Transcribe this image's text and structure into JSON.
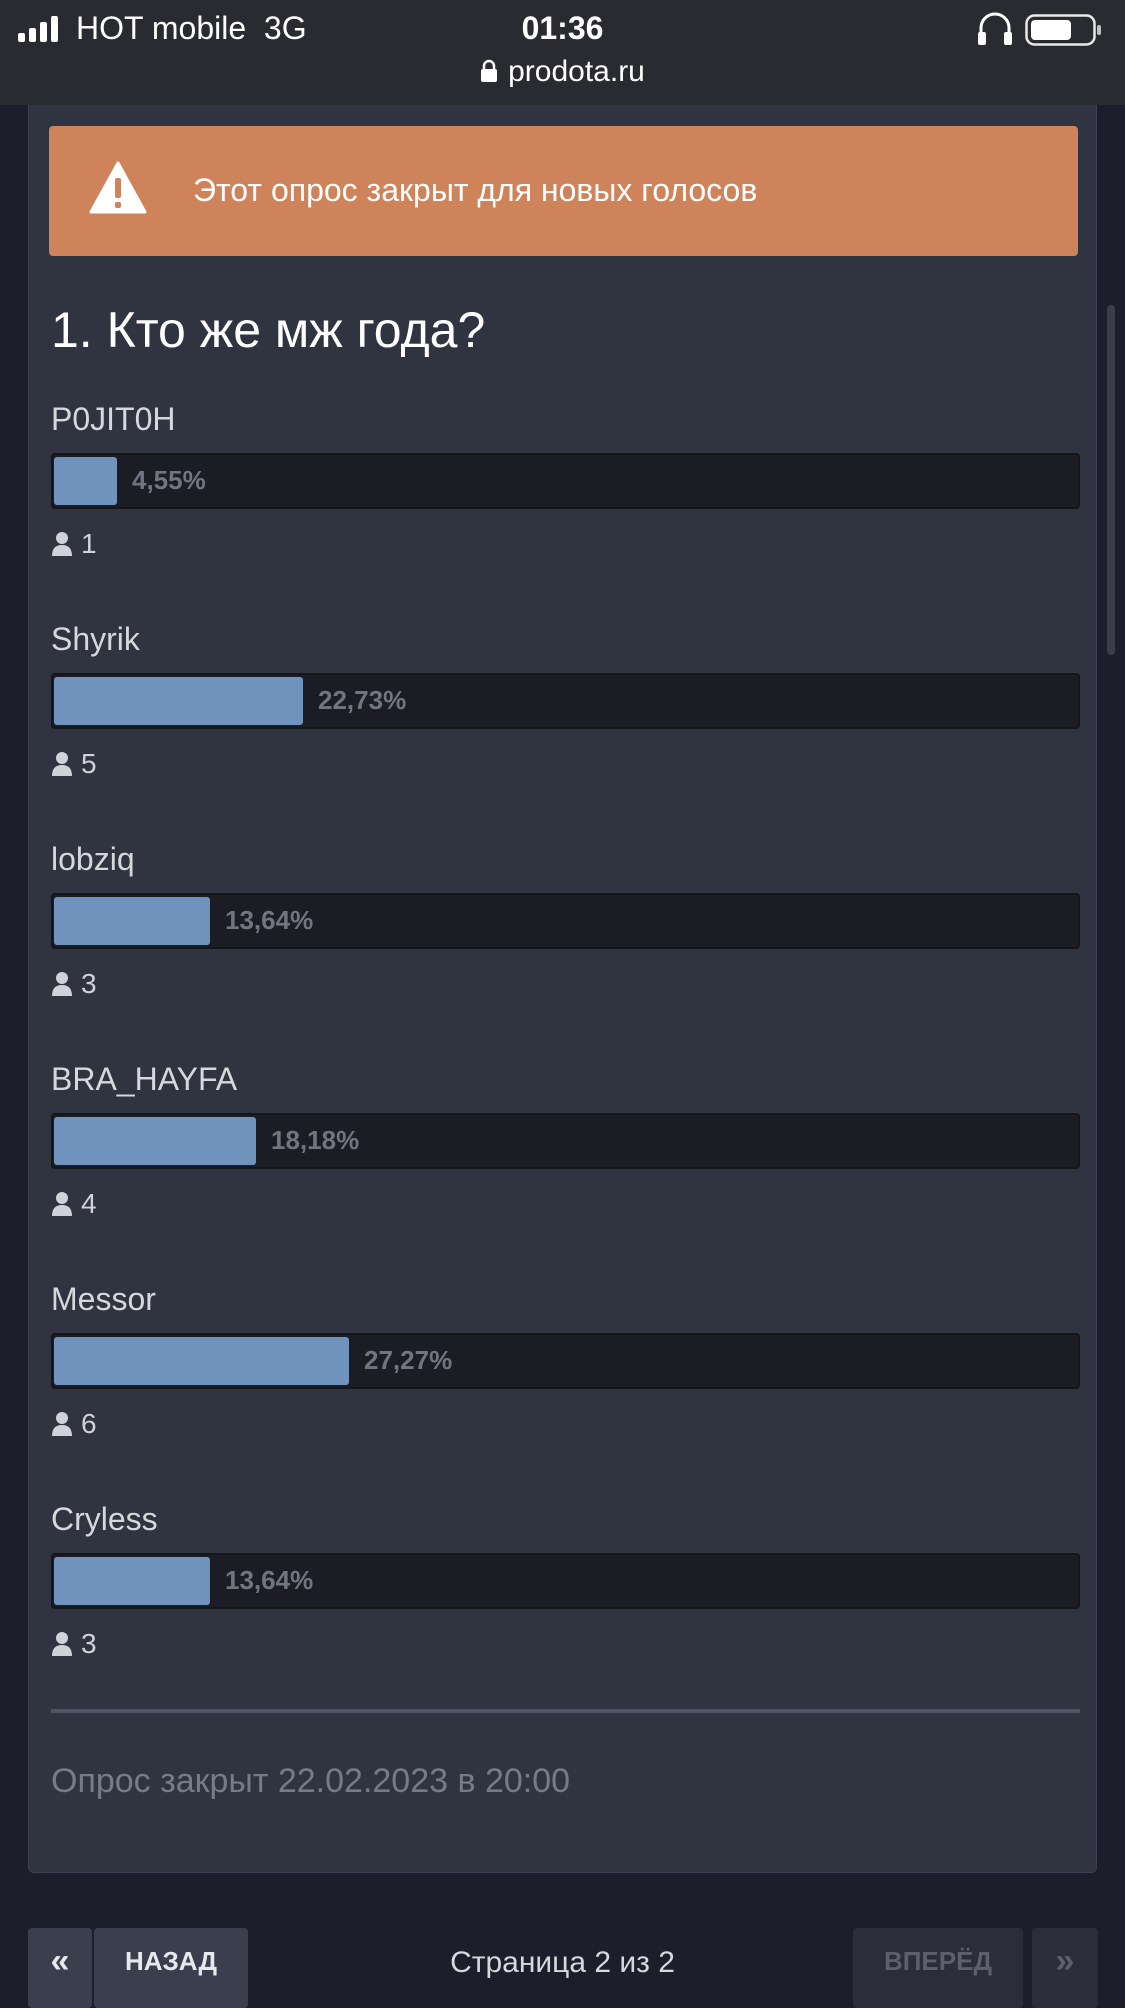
{
  "status_bar": {
    "carrier": "HOT mobile",
    "network": "3G",
    "time": "01:36",
    "url": "prodota.ru"
  },
  "notice": {
    "icon": "warning-triangle-icon",
    "text": "Этот опрос закрыт для новых голосов",
    "color": "#cf835b"
  },
  "poll": {
    "question": "1. Кто же мж года?",
    "bar_color": "#7093bd",
    "options": [
      {
        "name": "P0JIT0H",
        "percent_label": "4,55%",
        "percent": 4.55,
        "votes": "1"
      },
      {
        "name": "Shyrik",
        "percent_label": "22,73%",
        "percent": 22.73,
        "votes": "5"
      },
      {
        "name": "lobziq",
        "percent_label": "13,64%",
        "percent": 13.64,
        "votes": "3"
      },
      {
        "name": "BRA_HAYFA",
        "percent_label": "18,18%",
        "percent": 18.18,
        "votes": "4"
      },
      {
        "name": "Messor",
        "percent_label": "27,27%",
        "percent": 27.27,
        "votes": "6"
      },
      {
        "name": "Cryless",
        "percent_label": "13,64%",
        "percent": 13.64,
        "votes": "3"
      }
    ],
    "closed_text": "Опрос закрыт 22.02.2023 в 20:00"
  },
  "pagination": {
    "first_label": "«",
    "prev_label": "НАЗАД",
    "page_info": "Страница 2 из 2",
    "next_label": "ВПЕРЁД",
    "last_label": "»"
  }
}
